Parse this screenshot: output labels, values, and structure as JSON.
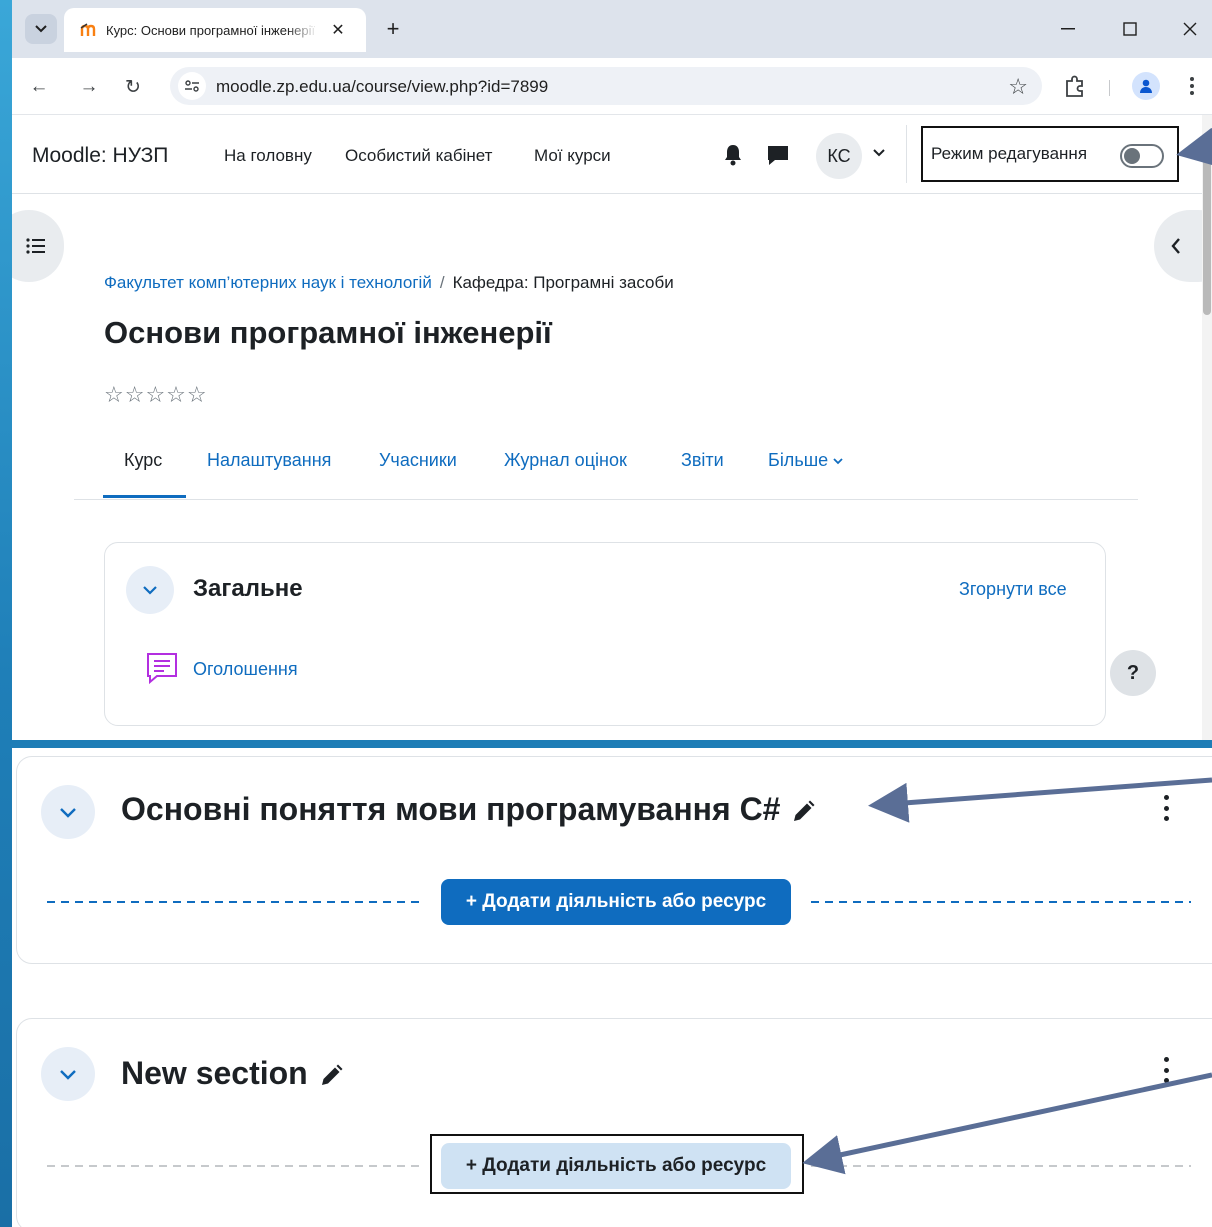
{
  "browser": {
    "tab_title": "Курс: Основи програмної інженерії",
    "url": "moodle.zp.edu.ua/course/view.php?id=7899",
    "new_tab_label": "+"
  },
  "navbar": {
    "brand": "Moodle: НУЗП",
    "links": [
      "На головну",
      "Особистий кабінет",
      "Мої курси"
    ],
    "avatar_initials": "КС",
    "edit_mode_label": "Режим редагування",
    "edit_mode_on": false
  },
  "breadcrumb": {
    "faculty": "Факультет комп’ютерних наук і технологій",
    "separator": "/",
    "department": "Кафедра: Програмні засоби"
  },
  "course": {
    "title": "Основи програмної інженерії",
    "stars": "☆☆☆☆☆"
  },
  "secondary_nav": {
    "items": [
      "Курс",
      "Налаштування",
      "Учасники",
      "Журнал оцінок",
      "Звіти",
      "Більше"
    ],
    "active_index": 0
  },
  "general_section": {
    "title": "Загальне",
    "collapse_all": "Згорнути все",
    "activity": "Оголошення"
  },
  "help": {
    "label": "?"
  },
  "edit_sections": [
    {
      "title": "Основні поняття мови програмування C#",
      "add_button": "+ Додати діяльність або ресурс"
    },
    {
      "title": "New section",
      "add_button": "+ Додати діяльність або ресурс"
    }
  ],
  "colors": {
    "moodle_blue": "#0f6cbf",
    "annotation_arrow": "#5a6e96",
    "slide_background": "#2a8fc4"
  }
}
